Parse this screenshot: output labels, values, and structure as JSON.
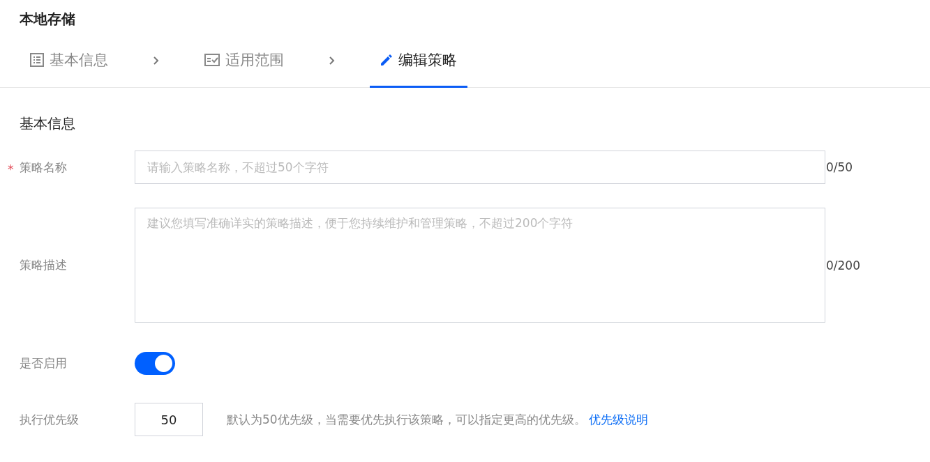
{
  "page_title": "本地存储",
  "steps": [
    {
      "kind": "list",
      "label": "基本信息",
      "selected": false
    },
    {
      "kind": "checkcard",
      "label": "适用范围",
      "selected": false
    },
    {
      "kind": "edit",
      "label": "编辑策略",
      "selected": true
    }
  ],
  "section_title": "基本信息",
  "fields": [
    {
      "kind": "text",
      "label": "策略名称",
      "required_mark": "*",
      "placeholder": "请输入策略名称，不超过50个字符",
      "counter": "0/50"
    },
    {
      "kind": "textarea",
      "label": "策略描述",
      "placeholder": "建议您填写准确详实的策略描述，便于您持续维护和管理策略，不超过200个字符",
      "counter": "0/200"
    },
    {
      "kind": "switch",
      "label": "是否启用",
      "on": true
    },
    {
      "kind": "number",
      "label": "执行优先级",
      "value": "50",
      "hint": "默认为50优先级，当需要优先执行该策略，可以指定更高的优先级。",
      "link": "优先级说明"
    }
  ]
}
